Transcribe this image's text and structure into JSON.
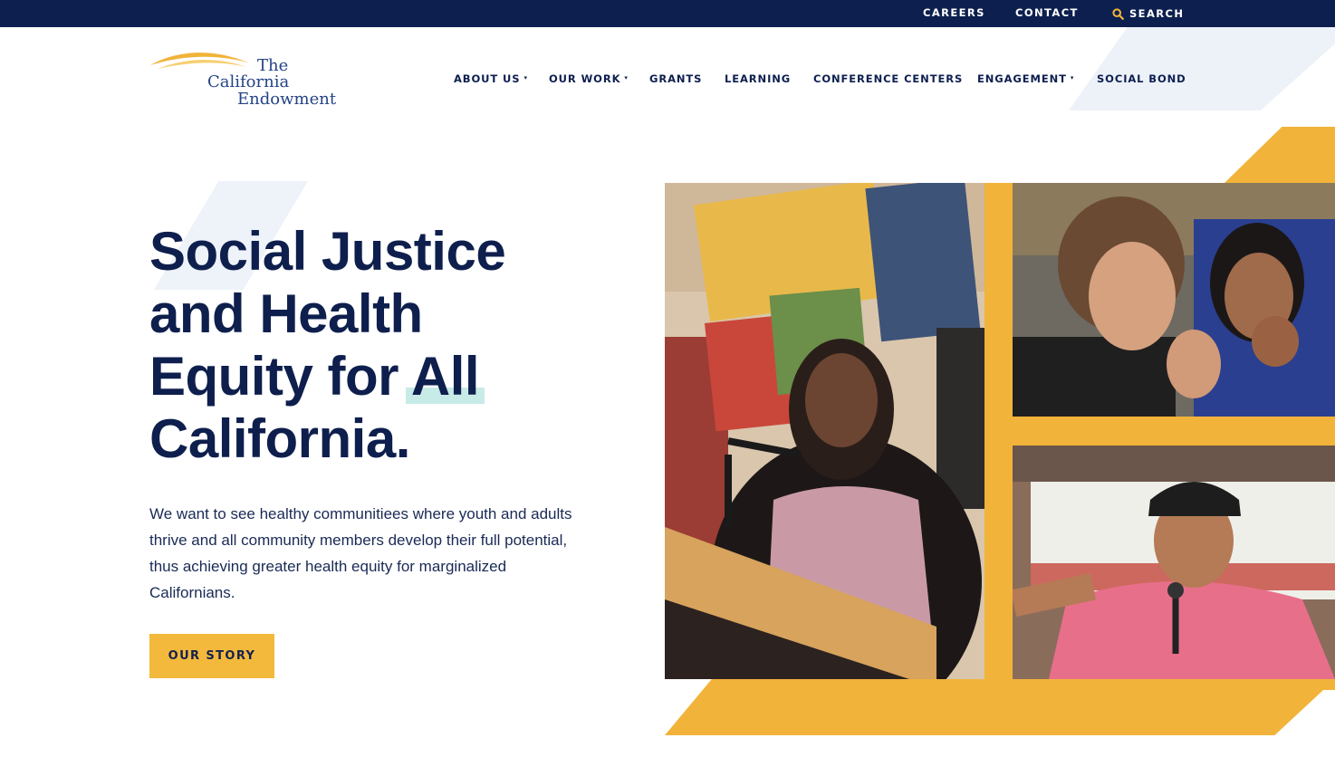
{
  "topbar": {
    "careers": "CAREERS",
    "contact": "CONTACT",
    "search": "SEARCH",
    "search_icon": "search-icon"
  },
  "logo": {
    "line1": "The",
    "line2": "California",
    "line3": "Endowment"
  },
  "nav": {
    "items": [
      {
        "label": "ABOUT US",
        "has_dropdown": true
      },
      {
        "label": "OUR WORK",
        "has_dropdown": true
      },
      {
        "label": "GRANTS",
        "has_dropdown": false
      },
      {
        "label": "LEARNING",
        "has_dropdown": false
      },
      {
        "label": "CONFERENCE CENTERS",
        "has_dropdown": false
      },
      {
        "label": "ENGAGEMENT",
        "has_dropdown": true
      },
      {
        "label": "SOCIAL BOND",
        "has_dropdown": false
      }
    ],
    "caret": "▾"
  },
  "hero": {
    "headline": [
      "Social Justice",
      "and Health",
      "Equity for All",
      "California."
    ],
    "lead": "We want to see healthy communitiees where youth and adults thrive and all community members develop their full potential, thus achieving greater health equity for marginalized Californians.",
    "cta": "OUR STORY"
  },
  "colors": {
    "navy": "#0c1f4e",
    "gold": "#f2b33a",
    "highlight": "#c7ebe6",
    "text": "#0e1f4d"
  }
}
